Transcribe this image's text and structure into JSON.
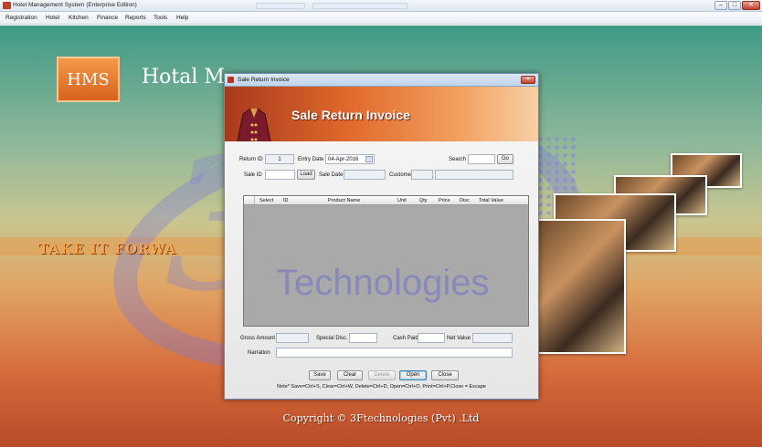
{
  "window": {
    "title": "Hotel Management System (Enterprise Edition)",
    "min": "–",
    "max": "□",
    "close": "✕"
  },
  "menu": [
    "Registration",
    "Hotel",
    "Kitchen",
    "Finance",
    "Reports",
    "Tools",
    "Help"
  ],
  "logo": {
    "text": "HMS"
  },
  "brand": {
    "text": "Hotal M"
  },
  "tagline": "TAKE IT FORWA",
  "copyright": "Copyright © 3Ftechnologies (Pvt) .Ltd",
  "watermark": {
    "text": "Technologies",
    "mark": "3f"
  },
  "dialog": {
    "title": "Sale Return Invoice",
    "close": "✕",
    "heading": "Sale Return Invoice",
    "labels": {
      "return_id": "Return ID",
      "entry_date": "Entry Date",
      "search": "Search",
      "sale_id": "Sale ID",
      "sale_date": "Sale Date",
      "customer": "Customer",
      "gross_amount": "Gross Amount",
      "special_disc": "Special Disc.",
      "cash_paid": "Cash Paid",
      "net_value": "Net Value",
      "narration": "Narration"
    },
    "fields": {
      "return_id": "1",
      "entry_date": "04-Apr-2016"
    },
    "buttons": {
      "go": "Go",
      "load": "Load",
      "save": "Save",
      "clear": "Clear",
      "delete": "Delete",
      "open": "Open",
      "close": "Close"
    },
    "grid_columns": [
      "Select",
      "ID",
      "Product Name",
      "Unit",
      "Qty",
      "Price",
      "Disc",
      "Total Value"
    ],
    "note": "Note* Save=Ctrl+S, Clear=Ctrl+W, Delete=Ctrl+D, Open=Ctrl+O, Print=Ctrl+P,Close = Escape"
  },
  "colors": {
    "accent": "#e06a2c",
    "bg_top": "#3f9a86",
    "bg_bottom": "#b84a28",
    "grid_bg": "#a9a9a9"
  }
}
